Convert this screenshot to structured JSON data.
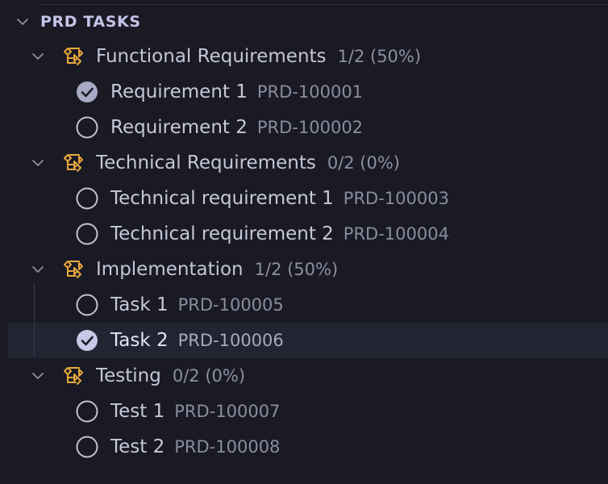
{
  "section": {
    "title": "PRD TASKS",
    "expanded": true
  },
  "groups": [
    {
      "label": "Functional Requirements",
      "progress": "1/2 (50%)",
      "icon": "task-hierarchy-icon",
      "tasks": [
        {
          "label": "Requirement 1",
          "id": "PRD-100001",
          "done": true
        },
        {
          "label": "Requirement 2",
          "id": "PRD-100002",
          "done": false
        }
      ]
    },
    {
      "label": "Technical Requirements",
      "progress": "0/2 (0%)",
      "icon": "task-hierarchy-icon",
      "tasks": [
        {
          "label": "Technical requirement 1",
          "id": "PRD-100003",
          "done": false
        },
        {
          "label": "Technical requirement 2",
          "id": "PRD-100004",
          "done": false
        }
      ]
    },
    {
      "label": "Implementation",
      "progress": "1/2 (50%)",
      "icon": "task-hierarchy-icon",
      "tasks": [
        {
          "label": "Task 1",
          "id": "PRD-100005",
          "done": false
        },
        {
          "label": "Task 2",
          "id": "PRD-100006",
          "done": true,
          "selected": true
        }
      ]
    },
    {
      "label": "Testing",
      "progress": "0/2 (0%)",
      "icon": "task-hierarchy-icon",
      "tasks": [
        {
          "label": "Test 1",
          "id": "PRD-100007",
          "done": false
        },
        {
          "label": "Test 2",
          "id": "PRD-100008",
          "done": false
        }
      ]
    }
  ],
  "colors": {
    "background": "#1a1a24",
    "group_icon": "#e8a93a",
    "checked_fill": "#a9a9c6",
    "selected_row": "#232432"
  }
}
